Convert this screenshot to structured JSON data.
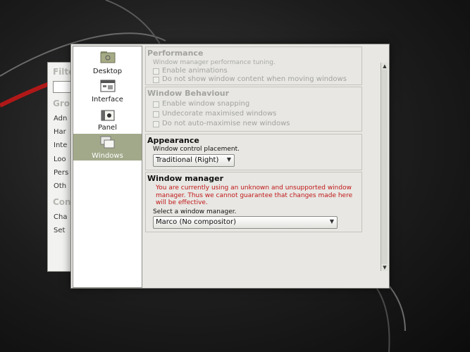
{
  "background_window": {
    "filter_label": "Filte",
    "groups_label": "Gro",
    "group_items": [
      "Adn",
      "Har",
      "Inte",
      "Loo",
      "Pers",
      "Oth"
    ],
    "common_label": "Con",
    "common_items": [
      "Cha",
      "Set"
    ]
  },
  "navigation": {
    "items": [
      {
        "label": "Desktop",
        "icon": "folder-icon",
        "selected": false
      },
      {
        "label": "Interface",
        "icon": "interface-icon",
        "selected": false
      },
      {
        "label": "Panel",
        "icon": "panel-icon",
        "selected": false
      },
      {
        "label": "Windows",
        "icon": "windows-icon",
        "selected": true
      }
    ]
  },
  "performance": {
    "title": "Performance",
    "description": "Window manager performance tuning.",
    "options": [
      "Enable animations",
      "Do not show window content when moving windows"
    ]
  },
  "window_behaviour": {
    "title": "Window Behaviour",
    "options": [
      "Enable window snapping",
      "Undecorate maximised windows",
      "Do not auto-maximise new windows"
    ]
  },
  "appearance": {
    "title": "Appearance",
    "control_label": "Window control placement.",
    "control_value": "Traditional (Right)"
  },
  "window_manager": {
    "title": "Window manager",
    "warning": "You are currently using an unknown and unsupported window manager. Thus we cannot guarantee that changes made here will be effective.",
    "select_label": "Select a window manager.",
    "select_value": "Marco (No compositor)"
  },
  "colors": {
    "selected_nav": "#a2a98a",
    "warning_text": "#c01818"
  }
}
